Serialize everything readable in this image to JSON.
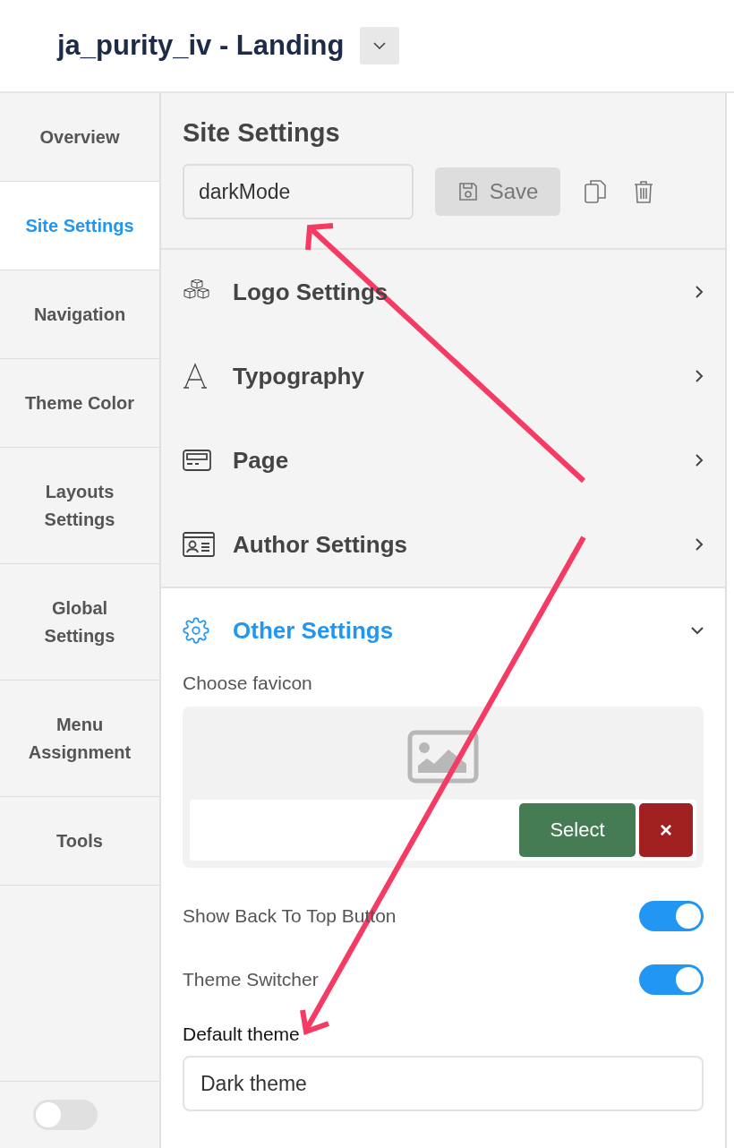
{
  "header": {
    "title": "ja_purity_iv - Landing"
  },
  "sidebar": {
    "items": [
      {
        "label": "Overview",
        "selected": false
      },
      {
        "label": "Site Settings",
        "selected": true
      },
      {
        "label": "Navigation",
        "selected": false
      },
      {
        "label": "Theme Color",
        "selected": false
      },
      {
        "label": "Layouts Settings",
        "selected": false
      },
      {
        "label": "Global Settings",
        "selected": false
      },
      {
        "label": "Menu Assignment",
        "selected": false
      },
      {
        "label": "Tools",
        "selected": false
      }
    ],
    "toggle": {
      "on": false
    }
  },
  "panel": {
    "title": "Site Settings",
    "name_value": "darkMode",
    "save_label": "Save",
    "sections": [
      {
        "label": "Logo Settings",
        "expanded": false
      },
      {
        "label": "Typography",
        "expanded": false
      },
      {
        "label": "Page",
        "expanded": false
      },
      {
        "label": "Author Settings",
        "expanded": false
      },
      {
        "label": "Other Settings",
        "expanded": true
      }
    ],
    "favicon_label": "Choose favicon",
    "select_label": "Select",
    "clear_label": "×",
    "toggles": [
      {
        "label": "Show Back To Top Button",
        "on": true
      },
      {
        "label": "Theme Switcher",
        "on": true
      }
    ],
    "default_theme_label": "Default theme",
    "default_theme_value": "Dark theme"
  }
}
